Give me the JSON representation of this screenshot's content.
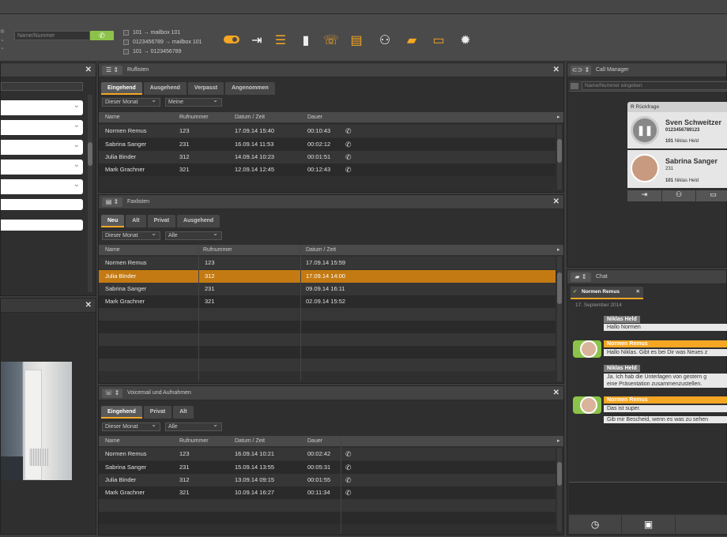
{
  "colors": {
    "accent": "#f5a623",
    "call_green": "#8bc34a",
    "highlight": "#c47a12"
  },
  "toolbar": {
    "search_placeholder": "Name/Nummer",
    "forwards": [
      "101 → mailbox 101",
      "0123456789 → mailbox 101",
      "101 → 0123456789"
    ],
    "icons": [
      "toggle-icon",
      "forward-icon",
      "list-icon",
      "contacts-icon",
      "hangup-icon",
      "queue-icon",
      "group-icon",
      "chat-icon",
      "notes-icon",
      "gear-icon"
    ]
  },
  "ruflisten": {
    "title": "Ruflisten",
    "tabs": [
      "Eingehend",
      "Ausgehend",
      "Verpasst",
      "Angenommen"
    ],
    "filters": [
      "Dieser Monat",
      "Meine"
    ],
    "columns": [
      "Name",
      "Rufnummer",
      "Datum / Zeit",
      "Dauer"
    ],
    "rows": [
      [
        "Normen Remus",
        "123",
        "17.09.14 15:40",
        "00:10:43"
      ],
      [
        "Sabrina Sanger",
        "231",
        "16.09.14 11:53",
        "00:02:12"
      ],
      [
        "Julia Binder",
        "312",
        "14.09.14 10:23",
        "00:01:51"
      ],
      [
        "Mark Grachner",
        "321",
        "12.09.14 12:45",
        "00:12:43"
      ]
    ]
  },
  "faxlisten": {
    "title": "Faxlisten",
    "tabs": [
      "Neu",
      "Alt",
      "Privat",
      "Ausgehend"
    ],
    "filters": [
      "Dieser Monat",
      "Alle"
    ],
    "columns": [
      "Name",
      "Rufnummer",
      "Datum / Zeit"
    ],
    "rows": [
      [
        "Normen Remus",
        "123",
        "17.09.14 15:59"
      ],
      [
        "Julia Binder",
        "312",
        "17.09.14 14:00"
      ],
      [
        "Sabrina Sanger",
        "231",
        "09.09.14 16:11"
      ],
      [
        "Mark Grachner",
        "321",
        "02.09.14 15:52"
      ]
    ]
  },
  "voicemail": {
    "title": "Voicemail und Aufnahmen",
    "tabs": [
      "Eingehend",
      "Privat",
      "Alt"
    ],
    "filters": [
      "Dieser Monat",
      "Alle"
    ],
    "columns": [
      "Name",
      "Rufnummer",
      "Datum / Zeit",
      "Dauer"
    ],
    "rows": [
      [
        "Normen Remus",
        "123",
        "16.09.14 10:21",
        "00:02:42"
      ],
      [
        "Sabrina Sanger",
        "231",
        "15.09.14 13:55",
        "00:05:31"
      ],
      [
        "Julia Binder",
        "312",
        "13.09.14 09:15",
        "00:01:55"
      ],
      [
        "Mark Grachner",
        "321",
        "10.09.14 16:27",
        "00:11:34"
      ]
    ]
  },
  "call_manager": {
    "title": "Call Manager",
    "placeholder": "Name/Nummer eingeben",
    "header": "Rückfrage",
    "calls": [
      {
        "name": "Sven Schweitzer",
        "number": "0123456789123",
        "line": "101",
        "line_user": "Niklas Held"
      },
      {
        "name": "Sabrina Sanger",
        "number": "231",
        "line": "101",
        "line_user": "Niklas Held"
      }
    ]
  },
  "chat": {
    "title": "Chat",
    "tab": "Normen Remus",
    "date": "17. September 2014",
    "messages": [
      {
        "from": "Niklas Held",
        "text": "Hallo Normen"
      },
      {
        "from": "Normen Remus",
        "text": "Hallo Niklas. Gibt es bei Dir was Neues z"
      },
      {
        "from": "Niklas Held",
        "text": "Ja. Ich hab die Unterlagen von gestern g",
        "text2": "eine Präsentation zusammenzustellen."
      },
      {
        "from": "Normen Remus",
        "text": "Das ist super.",
        "text2": "Gib mir Bescheid, wenn es was zu sehen"
      }
    ]
  }
}
